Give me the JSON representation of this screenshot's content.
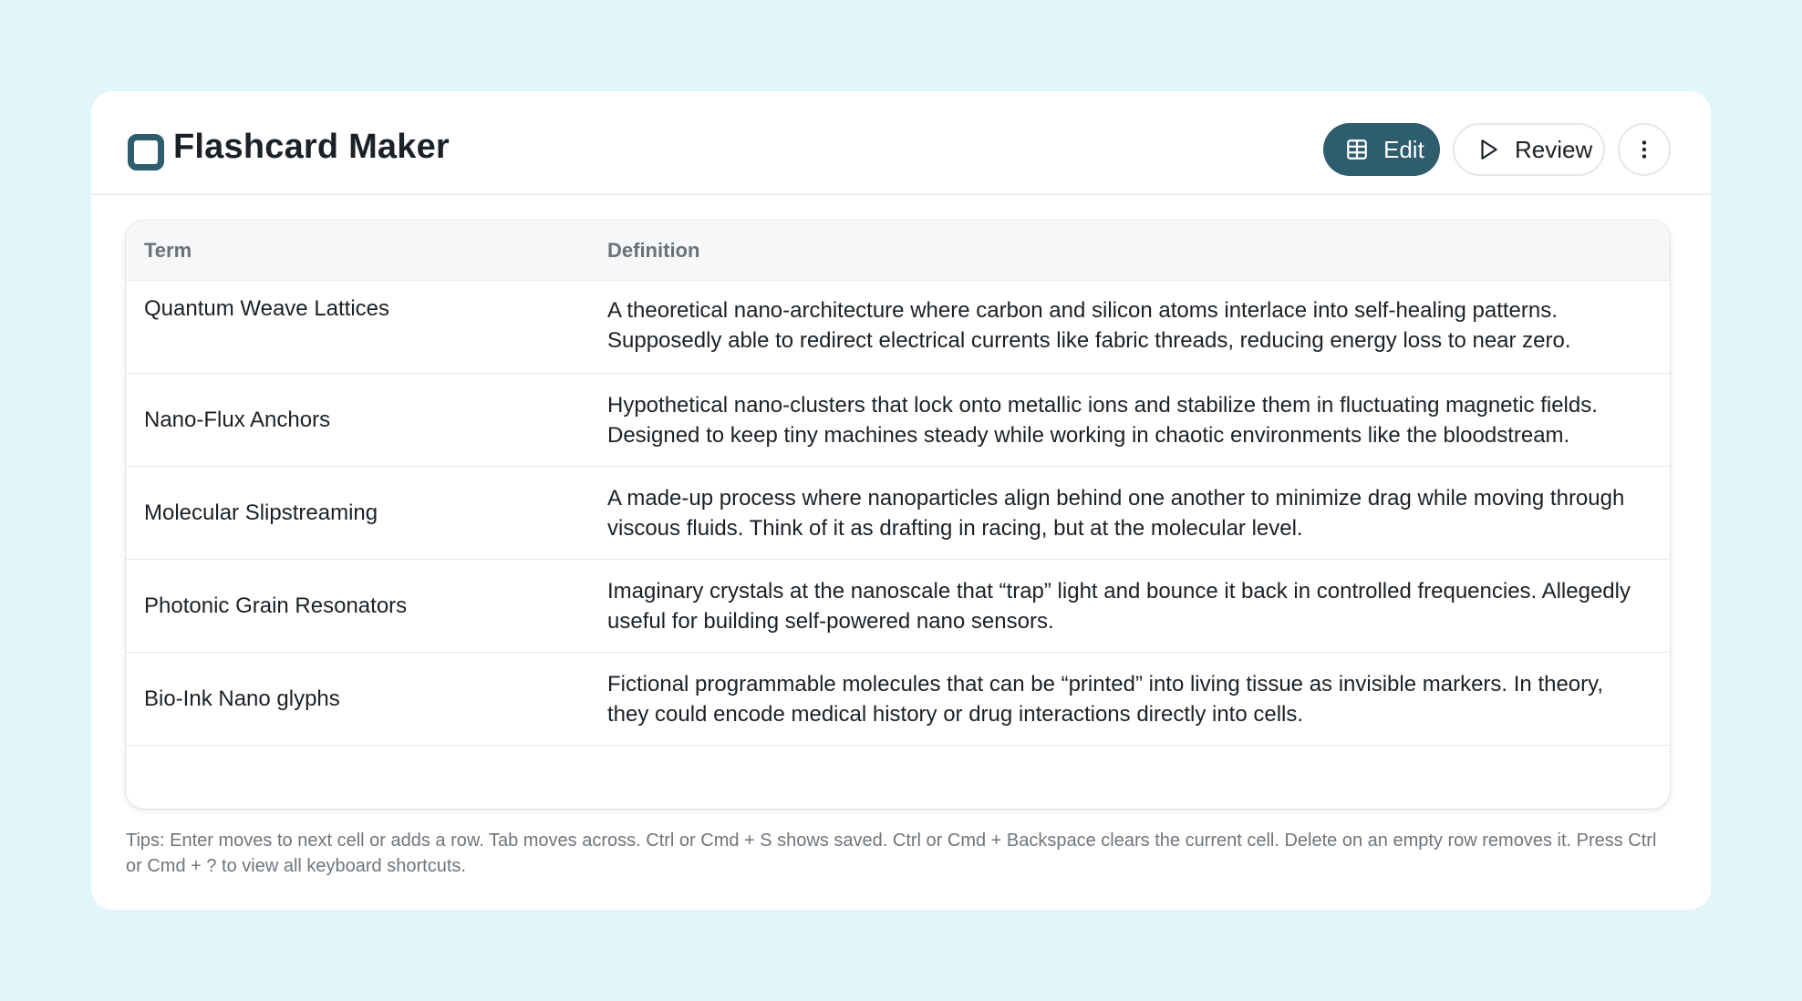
{
  "app": {
    "title": "Flashcard Maker",
    "accent_color": "#2e5d6e",
    "background_color": "#e2f6fa"
  },
  "toolbar": {
    "edit_label": "Edit",
    "edit_icon": "table-grid-icon",
    "review_label": "Review",
    "review_icon": "play-icon",
    "more_icon": "more-vertical-icon"
  },
  "table": {
    "headers": {
      "term": "Term",
      "definition": "Definition"
    },
    "rows": [
      {
        "term": "Quantum Weave Lattices",
        "definition": "A theoretical nano-architecture where carbon and silicon atoms interlace into self-healing patterns. Supposedly able to redirect electrical currents like fabric threads, reducing energy loss to near zero."
      },
      {
        "term": "Nano-Flux Anchors",
        "definition": "Hypothetical nano-clusters that lock onto metallic ions and stabilize them in fluctuating magnetic fields. Designed to keep tiny machines steady while working in chaotic environments like the bloodstream."
      },
      {
        "term": "Molecular Slipstreaming",
        "definition": "A made-up process where nanoparticles align behind one another to minimize drag while moving through viscous fluids. Think of it as drafting in racing, but at the molecular level."
      },
      {
        "term": "Photonic Grain Resonators",
        "definition": "Imaginary crystals at the nanoscale that “trap” light and bounce it back in controlled frequencies. Allegedly useful for building self-powered nano sensors."
      },
      {
        "term": "Bio-Ink Nano glyphs",
        "definition": "Fictional programmable molecules that can be “printed” into living tissue as invisible markers. In theory, they could encode medical history or drug interactions directly into cells."
      }
    ]
  },
  "footer": {
    "tips": "Tips: Enter moves to next cell or adds a row. Tab moves across. Ctrl or Cmd + S shows saved. Ctrl or Cmd + Backspace clears the current cell. Delete on an empty row removes it. Press Ctrl or Cmd + ? to view all keyboard shortcuts."
  }
}
